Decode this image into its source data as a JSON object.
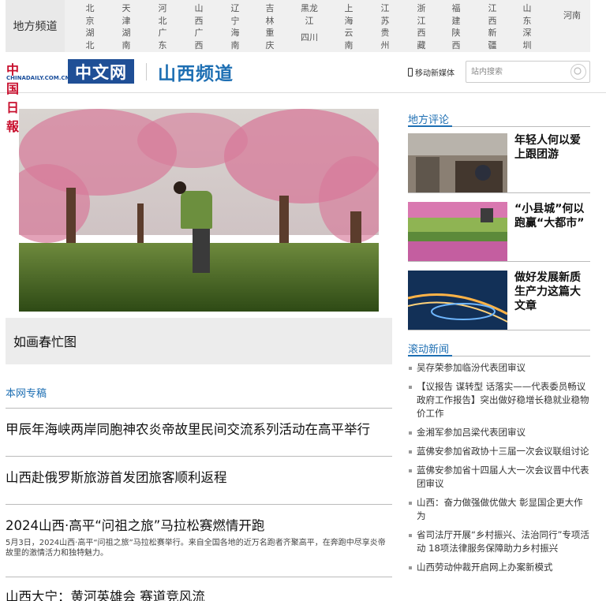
{
  "region_nav": {
    "label": "地方频道",
    "columns": [
      [
        "北京",
        "湖北"
      ],
      [
        "天津",
        "湖南"
      ],
      [
        "河北",
        "广东"
      ],
      [
        "山西",
        "广西"
      ],
      [
        "辽宁",
        "海南"
      ],
      [
        "吉林",
        "重庆"
      ],
      [
        "黑龙江",
        "四川"
      ],
      [
        "上海",
        "云南"
      ],
      [
        "江苏",
        "贵州"
      ],
      [
        "浙江",
        "西藏"
      ],
      [
        "福建",
        "陕西"
      ],
      [
        "江西",
        "新疆"
      ],
      [
        "山东",
        "深圳"
      ],
      [
        "河南"
      ]
    ]
  },
  "header": {
    "logo_cn": "中国日報",
    "logo_en": "CHINADAILY.COM.CN",
    "logo_box": "中文网",
    "channel_title": "山西频道",
    "mobile_link": "移动新媒体",
    "search_placeholder": "站内搜索"
  },
  "hero": {
    "caption": "如画春忙图"
  },
  "special": {
    "title": "本网专稿",
    "articles": [
      {
        "title": "甲辰年海峡两岸同胞神农炎帝故里民间交流系列活动在高平举行"
      },
      {
        "title": "山西赴俄罗斯旅游首发团旅客顺利返程"
      },
      {
        "title": "2024山西·高平“问祖之旅”马拉松赛燃情开跑",
        "desc": "5月3日，2024山西·高平“问祖之旅”马拉松赛举行。来自全国各地的近万名跑者齐聚高平，在奔跑中尽享炎帝故里的激情活力和独特魅力。"
      },
      {
        "title": "山西大宁：黄河英雄会 赛道竞风流"
      }
    ]
  },
  "commentary": {
    "title": "地方评论",
    "items": [
      {
        "text": "年轻人何以爱上跟团游"
      },
      {
        "text": "“小县城”何以跑赢“大都市”"
      },
      {
        "text": "做好发展新质生产力这篇大文章"
      }
    ]
  },
  "rolling_news": {
    "title": "滚动新闻",
    "items": [
      "吴存荣参加临汾代表团审议",
      "【议报告 谋转型 话落实——代表委员畅议政府工作报告】突出做好稳增长稳就业稳物价工作",
      "金湘军参加吕梁代表团审议",
      "蓝佛安参加省政协十三届一次会议联组讨论",
      "蓝佛安参加省十四届人大一次会议晋中代表团审议",
      "山西：奋力做强做优做大 彰显国企更大作为",
      "省司法厅开展“乡村振兴、法治同行”专项活动 18项法律服务保障助力乡村振兴",
      "山西劳动仲裁开启网上办案新模式"
    ]
  },
  "colors": {
    "accent_blue": "#1e6fb3",
    "logo_red": "#c8102e",
    "logo_box_blue": "#1f4f96"
  }
}
